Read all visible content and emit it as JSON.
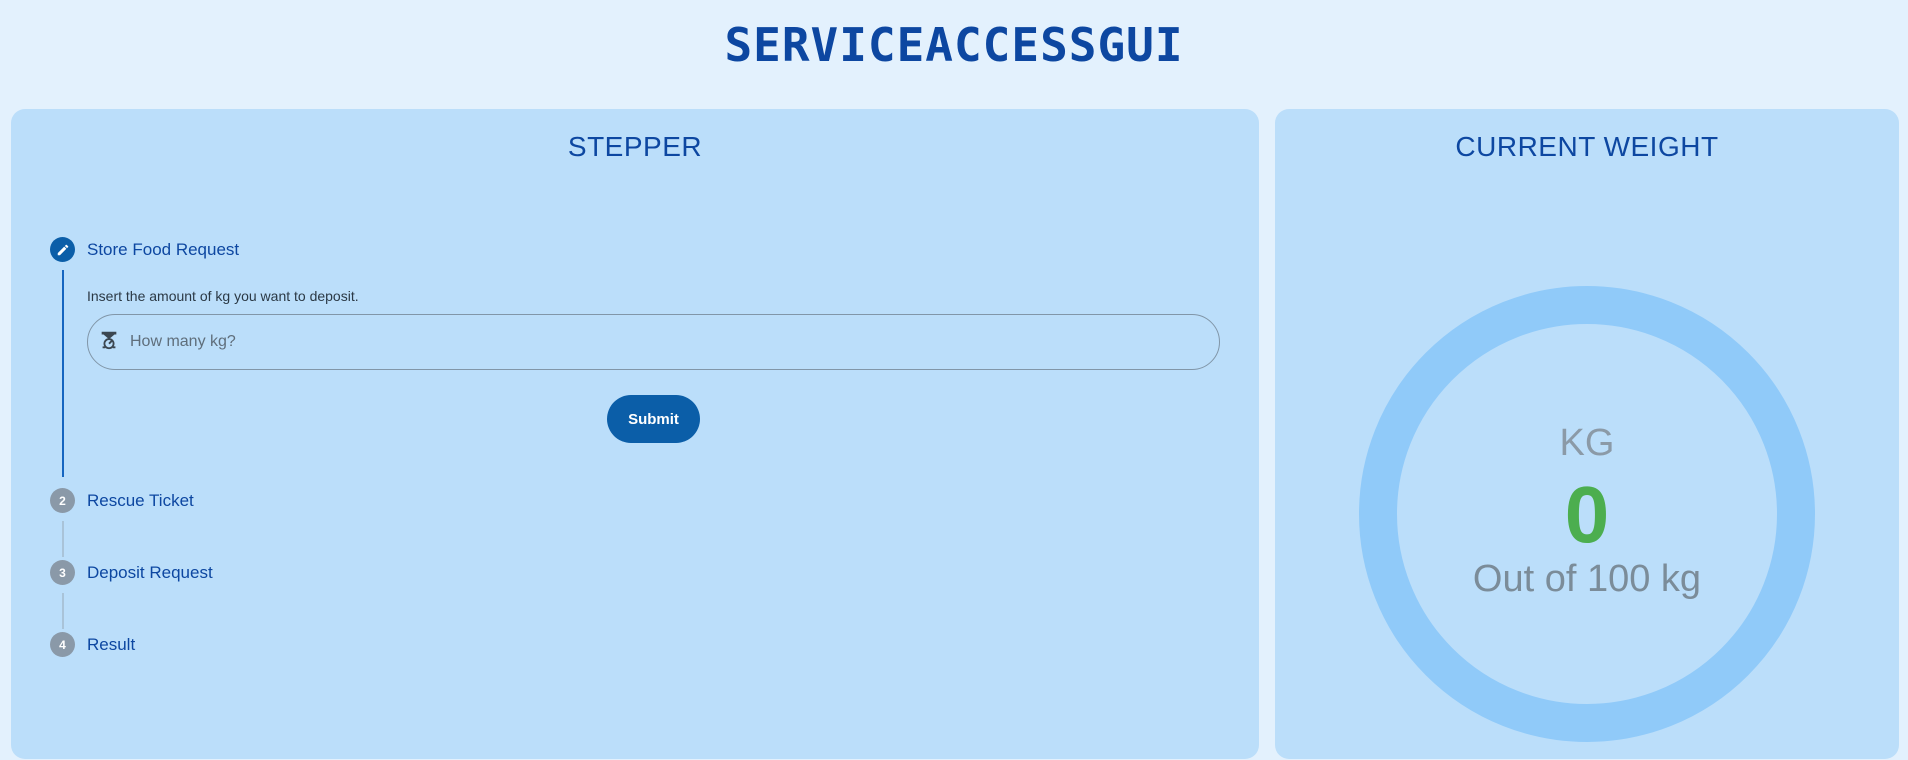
{
  "header": {
    "app_title": "SERVICEACCESSGUI"
  },
  "stepper": {
    "title": "STEPPER",
    "steps": [
      {
        "index": "1",
        "label": "Store Food Request",
        "icon": "pencil-icon",
        "state": "active"
      },
      {
        "index": "2",
        "label": "Rescue Ticket",
        "state": "inactive"
      },
      {
        "index": "3",
        "label": "Deposit Request",
        "state": "inactive"
      },
      {
        "index": "4",
        "label": "Result",
        "state": "inactive"
      }
    ],
    "active_step": {
      "instruction": "Insert the amount of kg you want to deposit.",
      "input_placeholder": "How many kg?",
      "input_value": "",
      "input_icon": "scale-icon",
      "submit_label": "Submit"
    }
  },
  "weight": {
    "title": "CURRENT WEIGHT",
    "unit": "KG",
    "value": "0",
    "max_caption": "Out of 100 kg",
    "current": 0,
    "max": 100,
    "colors": {
      "ring_track": "#90caf9",
      "value": "#4cae4f",
      "accent": "#0d47a1"
    }
  }
}
